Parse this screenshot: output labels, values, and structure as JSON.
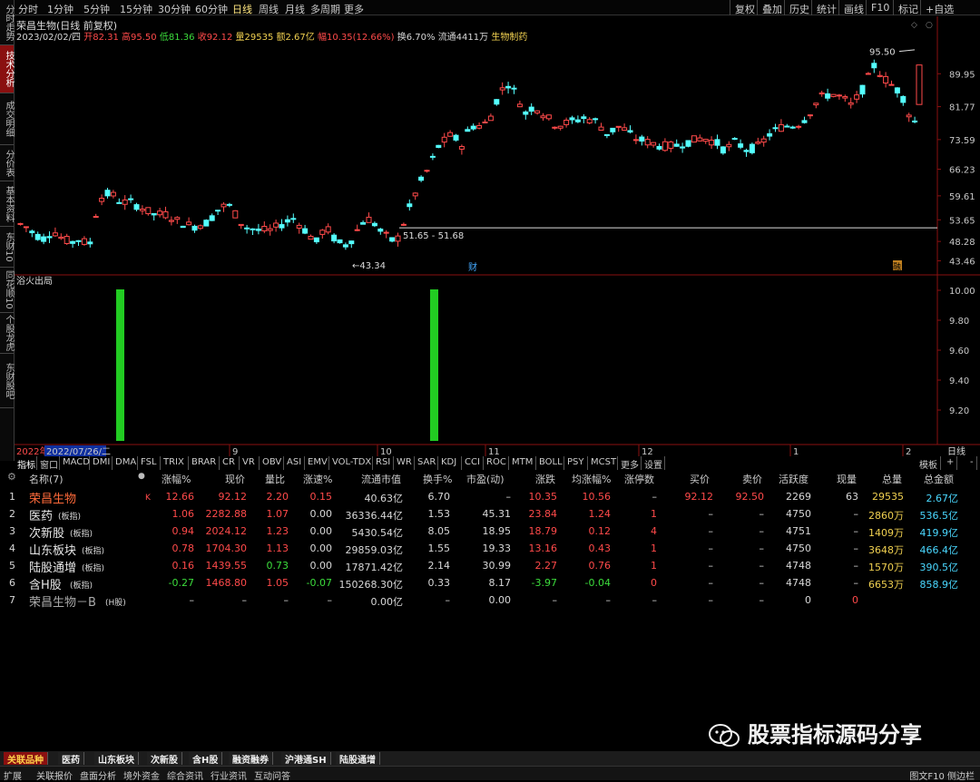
{
  "left_tabs": [
    "分时走势",
    "技术分析",
    "成交明细",
    "分价表",
    "基本资料",
    "东财10",
    "同花顺10",
    "个股龙虎",
    "东财股吧"
  ],
  "timeframes": [
    "分时",
    "1分钟",
    "5分钟",
    "15分钟",
    "30分钟",
    "60分钟",
    "日线",
    "周线",
    "月线",
    "多周期",
    "更多"
  ],
  "right_buttons": [
    "复权",
    "叠加",
    "历史",
    "统计",
    "画线",
    "F10",
    "标记",
    "+自选"
  ],
  "chart": {
    "title": "荣昌生物(日线 前复权)",
    "ohlc": {
      "date": "2023/02/02/四",
      "open_l": "开",
      "open": "82.31",
      "high_l": "高",
      "high": "95.50",
      "low_l": "低",
      "low": "81.36",
      "close_l": "收",
      "close": "92.12",
      "vol_l": "量",
      "vol": "29535",
      "amt_l": "额",
      "amt": "2.67亿",
      "amp_l": "幅",
      "amp": "10.35(12.66%)",
      "turn": "换6.70%",
      "float": "流通4411万",
      "sector": "生物制药"
    },
    "y_labels": [
      "89.95",
      "81.77",
      "73.59",
      "66.23",
      "59.61",
      "53.65",
      "48.28",
      "43.46"
    ],
    "max_label": "95.50",
    "min_label": "43.34",
    "range_label": "51.65 - 51.68",
    "marker_cai": "财",
    "marker_right": "融",
    "ind_title": "浴火出局",
    "ind_y_labels": [
      "10.00",
      "9.80",
      "9.60",
      "9.40",
      "9.20"
    ],
    "x_labels": [
      "2022年",
      "2022/07/26/二",
      "9",
      "10",
      "11",
      "12",
      "1",
      "2"
    ],
    "period_btn": "日线"
  },
  "indicator_tabs": [
    "指标",
    "窗口",
    "MACD",
    "DMI",
    "DMA",
    "FSL",
    "TRIX",
    "BRAR",
    "CR",
    "VR",
    "OBV",
    "ASI",
    "EMV",
    "VOL-TDX",
    "RSI",
    "WR",
    "SAR",
    "KDJ",
    "CCI",
    "ROC",
    "MTM",
    "BOLL",
    "PSY",
    "MCST",
    "更多",
    "设置"
  ],
  "right_tabs": [
    "模板",
    "+",
    "-"
  ],
  "table": {
    "headers": [
      "名称(7)",
      "涨幅%",
      "现价",
      "量比",
      "涨速%",
      "流通市值",
      "换手%",
      "市盈(动)",
      "涨跌",
      "均涨幅%",
      "涨停数",
      "买价",
      "卖价",
      "活跃度",
      "现量",
      "总量",
      "总金额"
    ],
    "rows": [
      {
        "i": "1",
        "name": "荣昌生物",
        "tag": "",
        "mark": "K",
        "chg": "12.66",
        "price": "92.12",
        "vr": "2.20",
        "spd": "0.15",
        "mcap": "40.63亿",
        "turn": "6.70",
        "pe": "–",
        "diff": "10.35",
        "avg": "10.56",
        "lim": "–",
        "bid": "92.12",
        "ask": "92.50",
        "act": "2269",
        "now": "63",
        "vol": "29535",
        "amt": "2.67亿"
      },
      {
        "i": "2",
        "name": "医药",
        "tag": "(板指)",
        "mark": "",
        "chg": "1.06",
        "price": "2282.88",
        "vr": "1.07",
        "spd": "0.00",
        "mcap": "36336.44亿",
        "turn": "1.53",
        "pe": "45.31",
        "diff": "23.84",
        "avg": "1.24",
        "lim": "1",
        "bid": "–",
        "ask": "–",
        "act": "4750",
        "now": "–",
        "vol": "2860万",
        "amt": "536.5亿"
      },
      {
        "i": "3",
        "name": "次新股",
        "tag": "(板指)",
        "mark": "",
        "chg": "0.94",
        "price": "2024.12",
        "vr": "1.23",
        "spd": "0.00",
        "mcap": "5430.54亿",
        "turn": "8.05",
        "pe": "18.95",
        "diff": "18.79",
        "avg": "0.12",
        "lim": "4",
        "bid": "–",
        "ask": "–",
        "act": "4751",
        "now": "–",
        "vol": "1409万",
        "amt": "419.9亿"
      },
      {
        "i": "4",
        "name": "山东板块",
        "tag": "(板指)",
        "mark": "",
        "chg": "0.78",
        "price": "1704.30",
        "vr": "1.13",
        "spd": "0.00",
        "mcap": "29859.03亿",
        "turn": "1.55",
        "pe": "19.33",
        "diff": "13.16",
        "avg": "0.43",
        "lim": "1",
        "bid": "–",
        "ask": "–",
        "act": "4750",
        "now": "–",
        "vol": "3648万",
        "amt": "466.4亿"
      },
      {
        "i": "5",
        "name": "陆股通增",
        "tag": "(板指)",
        "mark": "",
        "chg": "0.16",
        "price": "1439.55",
        "vr": "0.73",
        "spd": "0.00",
        "mcap": "17871.42亿",
        "turn": "2.14",
        "pe": "30.99",
        "diff": "2.27",
        "avg": "0.76",
        "lim": "1",
        "bid": "–",
        "ask": "–",
        "act": "4748",
        "now": "–",
        "vol": "1570万",
        "amt": "390.5亿"
      },
      {
        "i": "6",
        "name": "含H股",
        "tag": "(板指)",
        "mark": "",
        "chg": "-0.27",
        "price": "1468.80",
        "vr": "1.05",
        "spd": "-0.07",
        "mcap": "150268.30亿",
        "turn": "0.33",
        "pe": "8.17",
        "diff": "-3.97",
        "avg": "-0.04",
        "lim": "0",
        "bid": "–",
        "ask": "–",
        "act": "4748",
        "now": "–",
        "vol": "6653万",
        "amt": "858.9亿"
      },
      {
        "i": "7",
        "name": "荣昌生物－B",
        "tag": "(H股)",
        "mark": "",
        "chg": "–",
        "price": "–",
        "vr": "–",
        "spd": "–",
        "mcap": "0.00亿",
        "turn": "–",
        "pe": "0.00",
        "diff": "–",
        "avg": "–",
        "lim": "–",
        "bid": "–",
        "ask": "–",
        "act": "0",
        "now": "0",
        "vol": "",
        "amt": ""
      }
    ]
  },
  "bottom_tabs": [
    "关联品种",
    "医药",
    "山东板块",
    "次新股",
    "含H股",
    "融资融券",
    "沪港通SH",
    "陆股通增"
  ],
  "status": [
    "扩展",
    "关联报价",
    "盘面分析",
    "境外资金",
    "综合资讯",
    "行业资讯",
    "互动问答"
  ],
  "status_right": "图文F10 侧边栏",
  "watermark": "股票指标源码分享",
  "colors": {
    "up": "#ff4a4a",
    "down": "#3cdc3c",
    "candle_down": "#54ffff",
    "signal": "#22cc22"
  }
}
